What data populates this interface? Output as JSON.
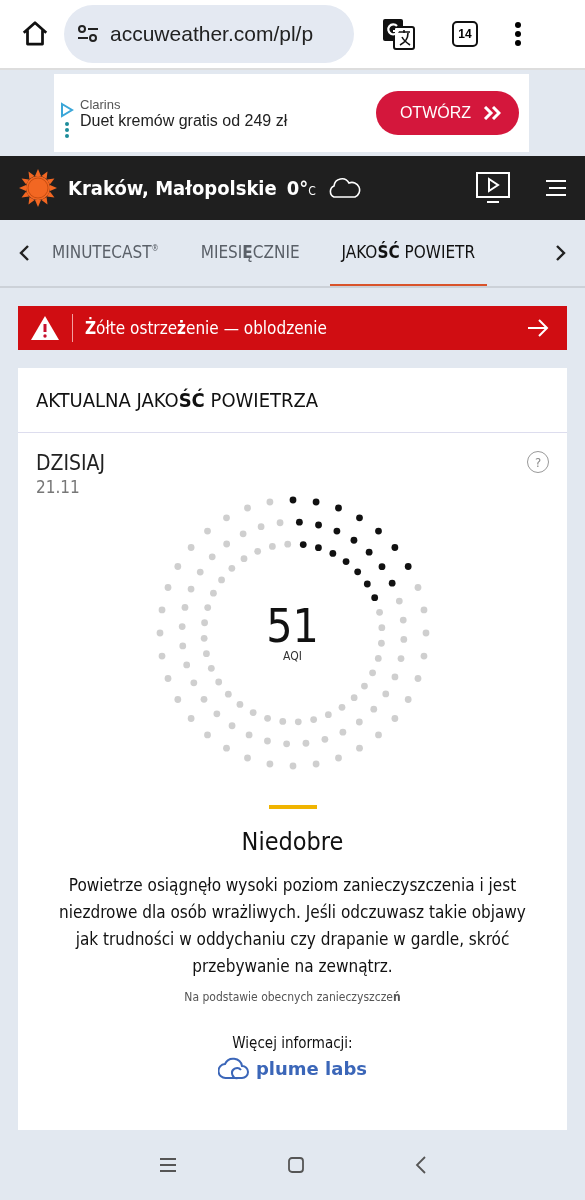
{
  "browser": {
    "url": "accuweather.com/pl/p",
    "tab_count": "14"
  },
  "ad": {
    "brand": "Clarins",
    "text": "Duet kremów gratis od 249 zł",
    "button": "OTWÓRZ"
  },
  "header": {
    "location": "Kraków, Małopolskie",
    "temperature": "0°",
    "unit": "C"
  },
  "tabs": [
    {
      "label": "MINUTECAST$^{®}$",
      "selected": false
    },
    {
      "label": "MIESI**Ę**CZNIE",
      "selected": false
    },
    {
      "label": "JAKO**ŚĆ** POWIETR",
      "selected": true
    }
  ],
  "alert": {
    "text": "**Ż**ółte ostrze**ż**enie — oblodzenie"
  },
  "card": {
    "title": "AKTUALNA JAKO**ŚĆ** POWIETRZA",
    "day": "DZISIAJ",
    "date": "21.11",
    "help": "?",
    "gauge": {
      "value": "51",
      "unit": "AQI",
      "color": "#f0b400"
    },
    "category": "Niedobre",
    "description": "Powietrze osiągnęło wysoki poziom zanieczyszczenia i jest niezdrowe dla osób wrażliwych. Jeśli odczuwasz takie objawy jak trudności w oddychaniu czy drapanie w gardle, skróć przebywanie na zewnątrz.",
    "note": "Na podstawie obecnych zanieczyszcze**ń**",
    "more": "Więcej informacji:",
    "source": "plume labs"
  }
}
